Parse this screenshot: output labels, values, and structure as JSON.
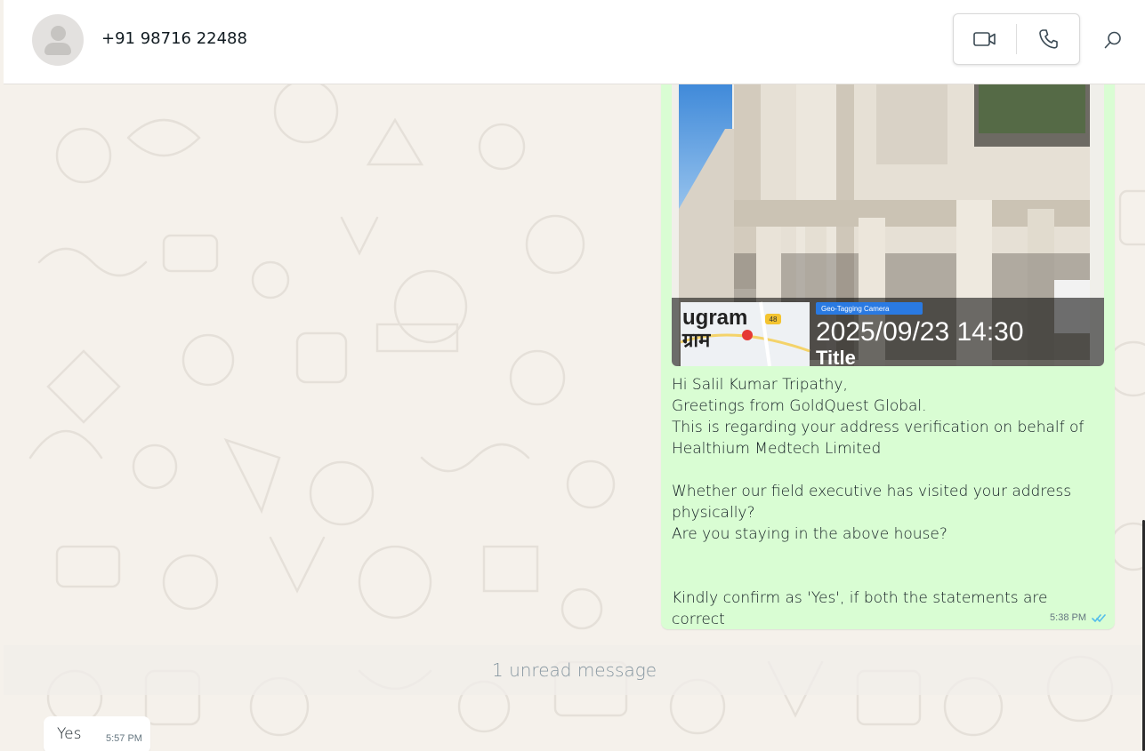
{
  "header": {
    "contact_name": "+91 98716 22488",
    "video_call_icon": "video-camera-icon",
    "voice_call_icon": "phone-icon",
    "search_icon": "search-icon"
  },
  "outgoing_message": {
    "image": {
      "map_label": "ugram",
      "map_label_hindi": "ग्राम",
      "road_badge": "48",
      "camera_tag": "Geo-Tagging Camera",
      "timestamp_overlay": "2025/09/23 14:30",
      "title_overlay": "Title"
    },
    "text": "Hi Salil Kumar Tripathy,\nGreetings from GoldQuest Global.\nThis is regarding your address verification on behalf of Healthium Medtech Limited\n\nWhether our field executive has visited your address physically?\nAre you staying in the above house?\n\n\nKindly confirm as 'Yes', if both the statements are correct",
    "time": "5:38 PM",
    "status_icon": "double-check-read-icon"
  },
  "divider": {
    "unread_label": "1 unread message"
  },
  "incoming_message": {
    "text": "Yes",
    "time": "5:57 PM"
  },
  "colors": {
    "outgoing_bubble": "#d9fdd3",
    "chat_background": "#f5f1eb",
    "read_tick": "#53bdeb"
  }
}
